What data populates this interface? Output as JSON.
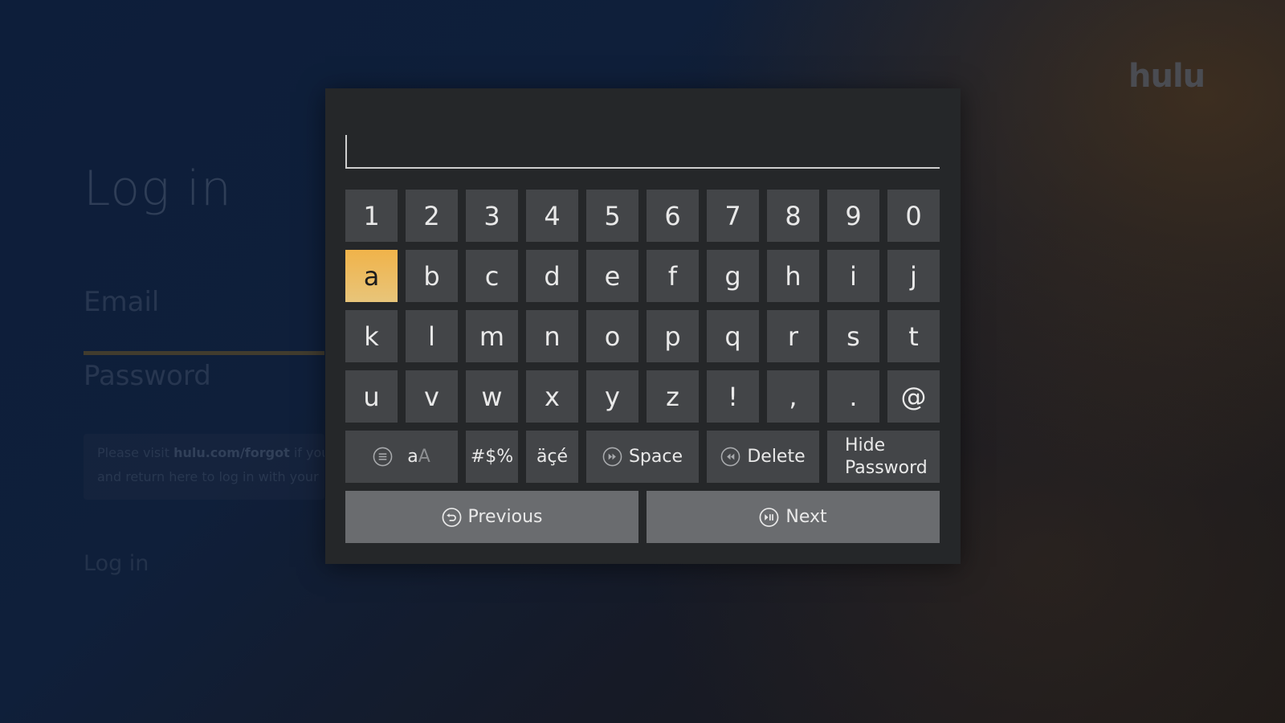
{
  "background": {
    "title": "Log in",
    "email_label": "Email",
    "password_label": "Password",
    "info_line1_prefix": "Please visit ",
    "info_line1_link": "hulu.com/forgot",
    "info_line1_suffix": " if you",
    "info_line2": "and return here to log in with your",
    "login_button": "Log in",
    "brand": "hulu"
  },
  "keyboard": {
    "input_value": "",
    "focused_key": "a",
    "rows": [
      [
        "1",
        "2",
        "3",
        "4",
        "5",
        "6",
        "7",
        "8",
        "9",
        "0"
      ],
      [
        "a",
        "b",
        "c",
        "d",
        "e",
        "f",
        "g",
        "h",
        "i",
        "j"
      ],
      [
        "k",
        "l",
        "m",
        "n",
        "o",
        "p",
        "q",
        "r",
        "s",
        "t"
      ],
      [
        "u",
        "v",
        "w",
        "x",
        "y",
        "z",
        "!",
        ",",
        ".",
        "@"
      ]
    ],
    "function_keys": {
      "case_toggle_lower": "a",
      "case_toggle_upper": "A",
      "symbols": "#$%",
      "accents": "äçé",
      "space": "Space",
      "delete": "Delete",
      "hide_password": "Hide\nPassword"
    },
    "actions": {
      "previous": "Previous",
      "next": "Next"
    }
  },
  "colors": {
    "focus_accent": "#f0b34a",
    "key_bg": "#434548",
    "action_bg": "#6a6c6f",
    "dialog_bg": "#252729"
  },
  "icons": {
    "case_toggle": "menu-icon",
    "space": "fast-forward-icon",
    "delete": "rewind-icon",
    "previous": "back-icon",
    "next": "play-pause-icon"
  }
}
